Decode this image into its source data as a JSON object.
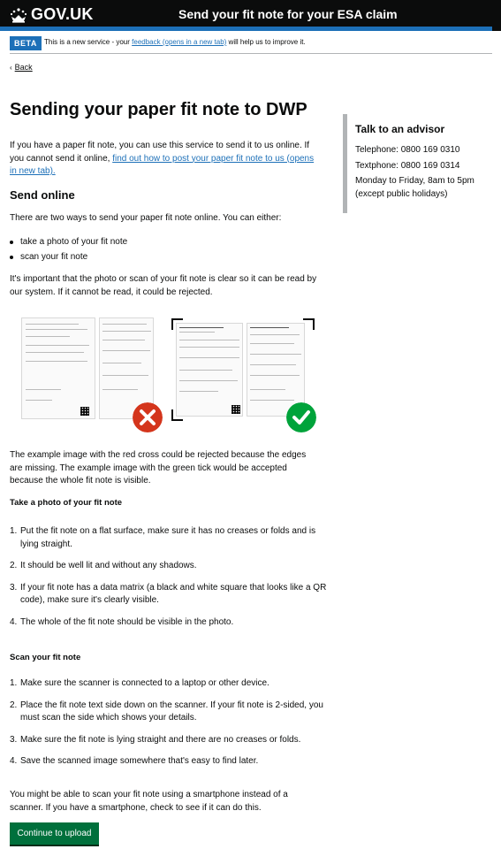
{
  "header": {
    "logo_text": "GOV.UK",
    "service_name": "Send your fit note for your ESA claim"
  },
  "beta": {
    "tag": "BETA",
    "text_before": "This is a new service - your ",
    "link": "feedback (opens in a new tab)",
    "text_after": " will help us to improve it."
  },
  "back_label": "Back",
  "main": {
    "title": "Sending your paper fit note to DWP",
    "intro_text": "If you have a paper fit note, you can use this service to send it to us online. If you cannot send it online, ",
    "intro_link": "find out how to post your paper fit note to us (opens in new tab).",
    "send_online_heading": "Send online",
    "two_ways": "There are two ways to send your paper fit note online. You can either:",
    "options": [
      "take a photo of your fit note",
      "scan your fit note"
    ],
    "clear_text": "It's important that the photo or scan of your fit note is clear so it can be read by our system. If it cannot be read, it could be rejected.",
    "example_text": "The example image with the red cross could be rejected because the edges are missing. The example image with the green tick would be accepted because the whole fit note is visible.",
    "photo_heading": "Take a photo of your fit note",
    "photo_steps": [
      "Put the fit note on a flat surface, make sure it has no creases or folds and is lying straight.",
      "It should be well lit and without any shadows.",
      "If your fit note has a data matrix (a black and white square that looks like a QR code), make sure it's clearly visible.",
      "The whole of the fit note should be visible in the photo."
    ],
    "scan_heading": "Scan your fit note",
    "scan_steps": [
      "Make sure the scanner is connected to a laptop or other device.",
      "Place the fit note text side down on the scanner. If your fit note is 2-sided, you must scan the side which shows your details.",
      "Make sure the fit note is lying straight and there are no creases or folds.",
      "Save the scanned image somewhere that's easy to find later."
    ],
    "smartphone_text": "You might be able to scan your fit note using a smartphone instead of a scanner. If you have a smartphone, check to see if it can do this.",
    "continue_button": "Continue to upload"
  },
  "sidebar": {
    "heading": "Talk to an advisor",
    "telephone": "Telephone: 0800 169 0310",
    "textphone": "Textphone: 0800 169 0314",
    "hours": "Monday to Friday, 8am to 5pm (except public holidays)"
  },
  "images": {
    "rejected_icon": "red-cross-icon",
    "accepted_icon": "green-tick-icon",
    "rejected_color": "#d4351c",
    "accepted_color": "#00a33b"
  }
}
